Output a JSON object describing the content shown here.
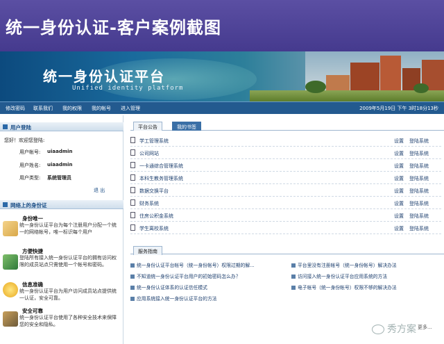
{
  "slide": {
    "title": "统一身份认证-客户案例截图"
  },
  "banner": {
    "title": "统一身份认证平台",
    "subtitle": "Unified identity platform"
  },
  "nav": {
    "items": [
      "修改密码",
      "联系我们",
      "我的权限",
      "我的帐号",
      "进入管理"
    ],
    "datetime": "2009年5月19日 下午 3时18分13秒"
  },
  "login_panel": {
    "title": "用户登陆",
    "welcome": "您好！欢迎您登陆:",
    "account_label": "用户帐号:",
    "account_value": "uiaadmin",
    "name_label": "用户姓名:",
    "name_value": "uiaadmin",
    "type_label": "用户类型:",
    "type_value": "系统管理员",
    "logout": "退 出"
  },
  "features_panel": {
    "title": "网络上的身份证",
    "items": [
      {
        "title": "身份唯一",
        "desc": "统一身份认证平台为每个注册用户分配一个统一的网络帐号，唯一标识每个用户",
        "icon": "id-card-icon"
      },
      {
        "title": "方便快捷",
        "desc": "登陆所有接入统一身份认证平台的拥有访问权限的成员站点只需使用一个帐号和密码。",
        "icon": "book-icon"
      },
      {
        "title": "信息准确",
        "desc": "统一身份认证平台为用户访问成员站点提供统一认证，安全可靠。",
        "icon": "bulb-icon"
      },
      {
        "title": "安全可靠",
        "desc": "统一身份认证平台使用了各种安全技术来保障您的安全和隐私。",
        "icon": "picture-icon"
      }
    ]
  },
  "main": {
    "tabs": [
      "平台公告",
      "我的书签"
    ],
    "active_tab": 1,
    "bookmarks": [
      "学工管理系统",
      "公司网站",
      "一卡通综合管理系统",
      "本科生教务管理系统",
      "数据交换平台",
      "财务系统",
      "住房公积金系统",
      "学生离校系统"
    ],
    "set_label": "设置",
    "login_label": "登陆系统",
    "guide_tab": "服务指南",
    "guide_items": [
      "统一身份认证平台帐号（统一身份帐号）权限过期的解...",
      "平台里没有注册帐号（统一身份帐号）解决办法",
      "不知道统一身份认证平台用户的初始密码怎么办？",
      "访问接入统一身份认证平台应用系统的方法",
      "统一身份认证体系的认证信任模式",
      "电子帐号（统一身份帐号）权限不够的解决办法",
      "应用系统接入统一身份认证平台的方法"
    ],
    "more": "更多..."
  },
  "watermark": "秀方案"
}
